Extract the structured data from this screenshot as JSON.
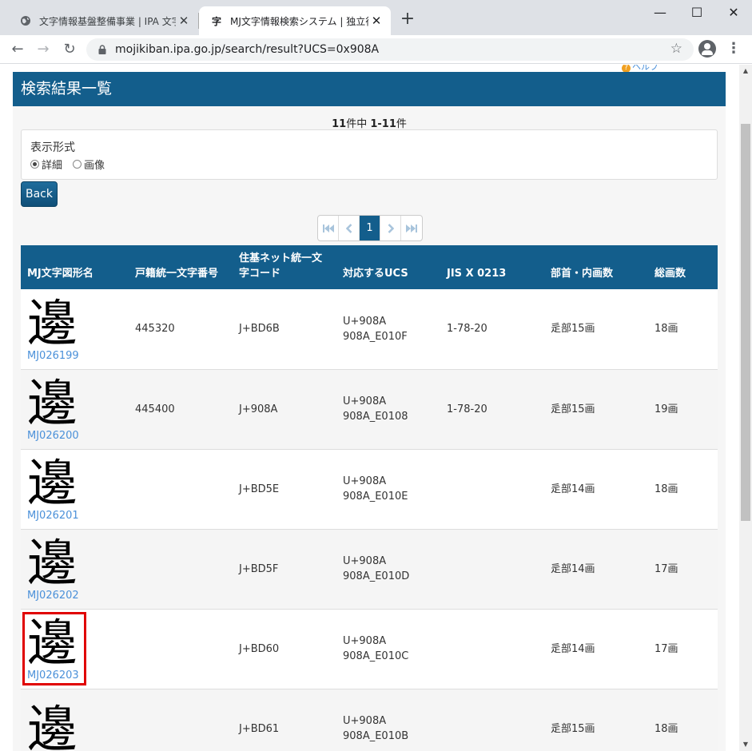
{
  "browser": {
    "tabs": [
      {
        "title": "文字情報基盤整備事業 | IPA 文字",
        "favicon": "globe-icon",
        "active": false
      },
      {
        "title": "MJ文字情報検索システム | 独立行政",
        "favicon": "moji-icon",
        "favicon_text": "字",
        "active": true
      }
    ],
    "url": "mojikiban.ipa.go.jp/search/result?UCS=0x908A"
  },
  "page": {
    "help_label": "ヘルプ",
    "header_title": "検索結果一覧",
    "count": {
      "total": "11",
      "mid": "件中 ",
      "range": "1-11",
      "suffix": "件"
    },
    "display": {
      "legend": "表示形式",
      "options": [
        {
          "label": "詳細",
          "checked": true
        },
        {
          "label": "画像",
          "checked": false
        }
      ]
    },
    "back_label": "Back",
    "pagination": {
      "current": "1"
    }
  },
  "table": {
    "headers": [
      "MJ文字図形名",
      "戸籍統一文字番号",
      "住基ネット統一文字コード",
      "対応するUCS",
      "JIS X 0213",
      "部首・内画数",
      "総画数"
    ],
    "rows": [
      {
        "glyph": "邊",
        "mj": "MJ026199",
        "koseki": "445320",
        "juki": "J+BD6B",
        "ucs1": "U+908A",
        "ucs2": "908A_E010F",
        "jis": "1-78-20",
        "bushu": "辵部15画",
        "total": "18画"
      },
      {
        "glyph": "邊",
        "mj": "MJ026200",
        "koseki": "445400",
        "juki": "J+908A",
        "ucs1": "U+908A",
        "ucs2": "908A_E0108",
        "jis": "1-78-20",
        "bushu": "辵部15画",
        "total": "19画"
      },
      {
        "glyph": "邊",
        "mj": "MJ026201",
        "koseki": "",
        "juki": "J+BD5E",
        "ucs1": "U+908A",
        "ucs2": "908A_E010E",
        "jis": "",
        "bushu": "辵部14画",
        "total": "18画"
      },
      {
        "glyph": "邊",
        "mj": "MJ026202",
        "koseki": "",
        "juki": "J+BD5F",
        "ucs1": "U+908A",
        "ucs2": "908A_E010D",
        "jis": "",
        "bushu": "辵部14画",
        "total": "17画"
      },
      {
        "glyph": "邊",
        "mj": "MJ026203",
        "koseki": "",
        "juki": "J+BD60",
        "ucs1": "U+908A",
        "ucs2": "908A_E010C",
        "jis": "",
        "bushu": "辵部14画",
        "total": "17画",
        "highlighted": true
      },
      {
        "glyph": "邊",
        "mj": "",
        "koseki": "",
        "juki": "J+BD61",
        "ucs1": "U+908A",
        "ucs2": "908A_E010B",
        "jis": "",
        "bushu": "辵部15画",
        "total": "18画"
      }
    ]
  },
  "colors": {
    "accent": "#135e8c",
    "link": "#4a90d9",
    "highlight": "#e00000"
  }
}
